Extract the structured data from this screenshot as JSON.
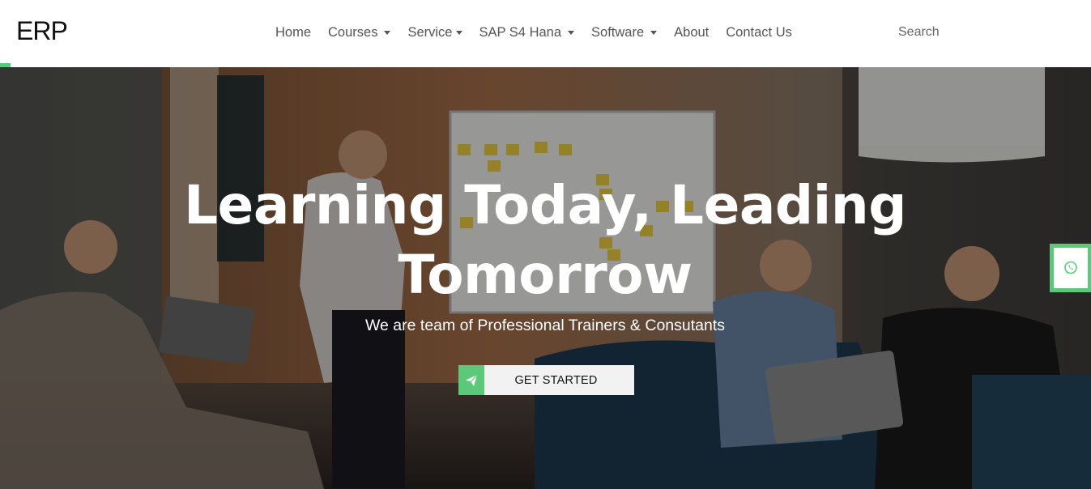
{
  "brand": {
    "logo_text": "ERP"
  },
  "nav": {
    "items": [
      {
        "label": "Home",
        "dropdown": false
      },
      {
        "label": "Courses",
        "dropdown": true
      },
      {
        "label": "Service",
        "dropdown": true
      },
      {
        "label": "SAP S4 Hana",
        "dropdown": true
      },
      {
        "label": "Software",
        "dropdown": true
      },
      {
        "label": "About",
        "dropdown": false
      },
      {
        "label": "Contact Us",
        "dropdown": false
      }
    ],
    "search_placeholder": "Search"
  },
  "hero": {
    "title_line1": "Learning Today, Leading",
    "title_line2": "Tomorrow",
    "subtitle": "We are team of Professional Trainers & Consutants",
    "cta_label": "GET STARTED",
    "cta_icon": "paper-plane-icon"
  },
  "floating": {
    "icon": "whatsapp-icon"
  },
  "colors": {
    "accent": "#5cc97a",
    "nav_text": "#555555",
    "hero_text": "#ffffff"
  }
}
